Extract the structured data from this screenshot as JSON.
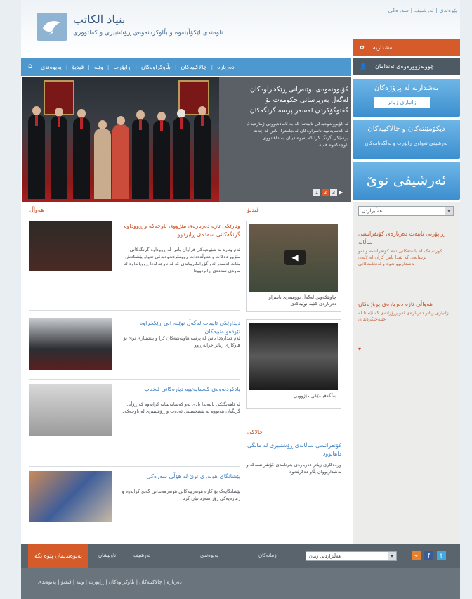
{
  "header": {
    "top_links": "پێوەندی | ئەرشیف | سەرەکی",
    "site_title": "بنیاد الكاتب",
    "site_subtitle": "ناوەندی لێکۆڵینەوە و بڵاوکردنەوەی ڕۆشنبیری و کەلتووری"
  },
  "nav": {
    "home_icon": "home-icon",
    "items": [
      "دەربارە",
      "چالاکییەکان",
      "بڵاوکراوەکان",
      "ڕاپۆرت",
      "وێنە",
      "ڤیدیۆ",
      "پەیوەندی"
    ]
  },
  "right": {
    "orange_button": "بەشداربە",
    "dark_button": "چوونەژوورەوەی ئەندامان",
    "promo1_title": "بەشداربە لە پڕۆژەکان",
    "promo1_button": "زانیاری زیاتر",
    "promo2_title": "دیکۆمێنتەکان و چالاکییەکان",
    "promo2_sub": "ئەرشیفی تەواوی ڕاپۆرت و بەڵگەنامەکان",
    "promo3_title": "ئەرشیفی نوێ",
    "dropdown": "هەڵبژاردن",
    "items": [
      {
        "title": "ڕاپۆرتی تایبەت دەربارەی کۆنفرانسی ساڵانە",
        "text": "کورتەیەک لە بابەتەکانی ئەم کۆنفرانسە و ئەو پرسانەی کە تێیدا باس کران لە لایەن بەشداربووانەوە و ئەنجامەکانی"
      },
      {
        "title": "هەواڵی تازە دەربارەی پڕۆژەکان",
        "text": "زانیاری زیاتر دەربارەی ئەو پڕۆژانەی کە ئێستا لە جێبەجێکردندان"
      }
    ]
  },
  "hero": {
    "title": "کۆبوونەوەی نوێنەرانی ڕێکخراوەکان لەگەڵ بەرپرسانی حکومەت بۆ گفتوگۆکردن لەسەر پرسە گرنگەکان",
    "body": "لە کۆبوونەوەیەکی تایبەتدا کە بە ئامادەبوونی ژمارەیەک لە کەسایەتییە ناسراوەکان ئەنجامدرا، باس لە چەند پرسێکی گرنگ کرا کە پەیوەندییان بە داهاتووی ناوچەکەوە هەیە",
    "pages": [
      "1",
      "2",
      "3"
    ]
  },
  "content": {
    "news_heading": "هەواڵ",
    "video_heading": "ڤیدیۆ",
    "events_heading": "چالاکی",
    "articles": [
      {
        "title": "وتارێکی تازە دەربارەی مێژووی ناوچەکە و ڕووداوە گرنگەکانی سەدەی ڕابردوو",
        "text": "ئەم وتارە بە شێوەیەکی فراوان باس لە ڕووداوە گرنگەکانی مێژوو دەکات و هەوڵدەدات ڕوونکردنەوەیەکی تەواو پێشکەش بکات لەسەر ئەو گۆڕانکارییانەی کە لە ناوچەکەدا ڕوویانداوە لە ماوەی سەدەی ڕابردوودا"
      },
      {
        "title": "دیدارێکی تایبەت لەگەڵ نوێنەرانی ڕێکخراوە نێودەوڵەتییەکان",
        "text": "لەم دیدارەدا باس لە پرسە هاوبەشەکان کرا و پێشنیاری نوێ بۆ هاوکاری زیاتر خرایە ڕوو"
      },
      {
        "title": "یادکردنەوەی کەسایەتییە دیارەکانی ئەدەب",
        "text": "لە ئاهەنگێکی تایبەتدا یادی ئەو کەسایەتییانە کرایەوە کە ڕۆڵی گرنگیان هەبووە لە پێشخستنی ئەدەب و ڕۆشنبیری لە ناوچەکەدا"
      },
      {
        "title": "پێشانگای هونەری نوێ لە هۆڵی سەرەکی",
        "text": "پێشانگایەک بۆ کارە هونەرییەکانی هونەرمەندانی گەنج کرایەوە و ژمارەیەکی زۆر سەردانیان کرد"
      }
    ],
    "videos": [
      {
        "caption": "چاوپێکەوتن لەگەڵ نووسەری ناسراو دەربارەی کتێبە نوێیەکەی"
      },
      {
        "caption": "بەڵگەفیلمێکی مێژوویی"
      }
    ],
    "event": {
      "title": "کۆنفرانسی ساڵانەی ڕۆشنبیری لە مانگی داهاتوودا",
      "text": "وردەکاری زیاتر دەربارەی بەرنامەی کۆنفرانسەکە و بەشداربووان بڵاو دەکرێتەوە"
    }
  },
  "footer": {
    "tab": "پەیوەندیمان پێوە بکە",
    "links1": [
      "ناونیشان",
      "ئەرشیف"
    ],
    "label_mid": "پەیوەندی",
    "label_lang": "زمانەکان",
    "select_value": "هەڵبژاردنی زمان",
    "social": [
      "rss-icon",
      "facebook-icon",
      "twitter-icon"
    ],
    "links2": "دەربارە | چالاکییەکان | بڵاوکراوەکان | ڕاپۆرت | وێنە | ڤیدیۆ | پەیوەندی"
  }
}
